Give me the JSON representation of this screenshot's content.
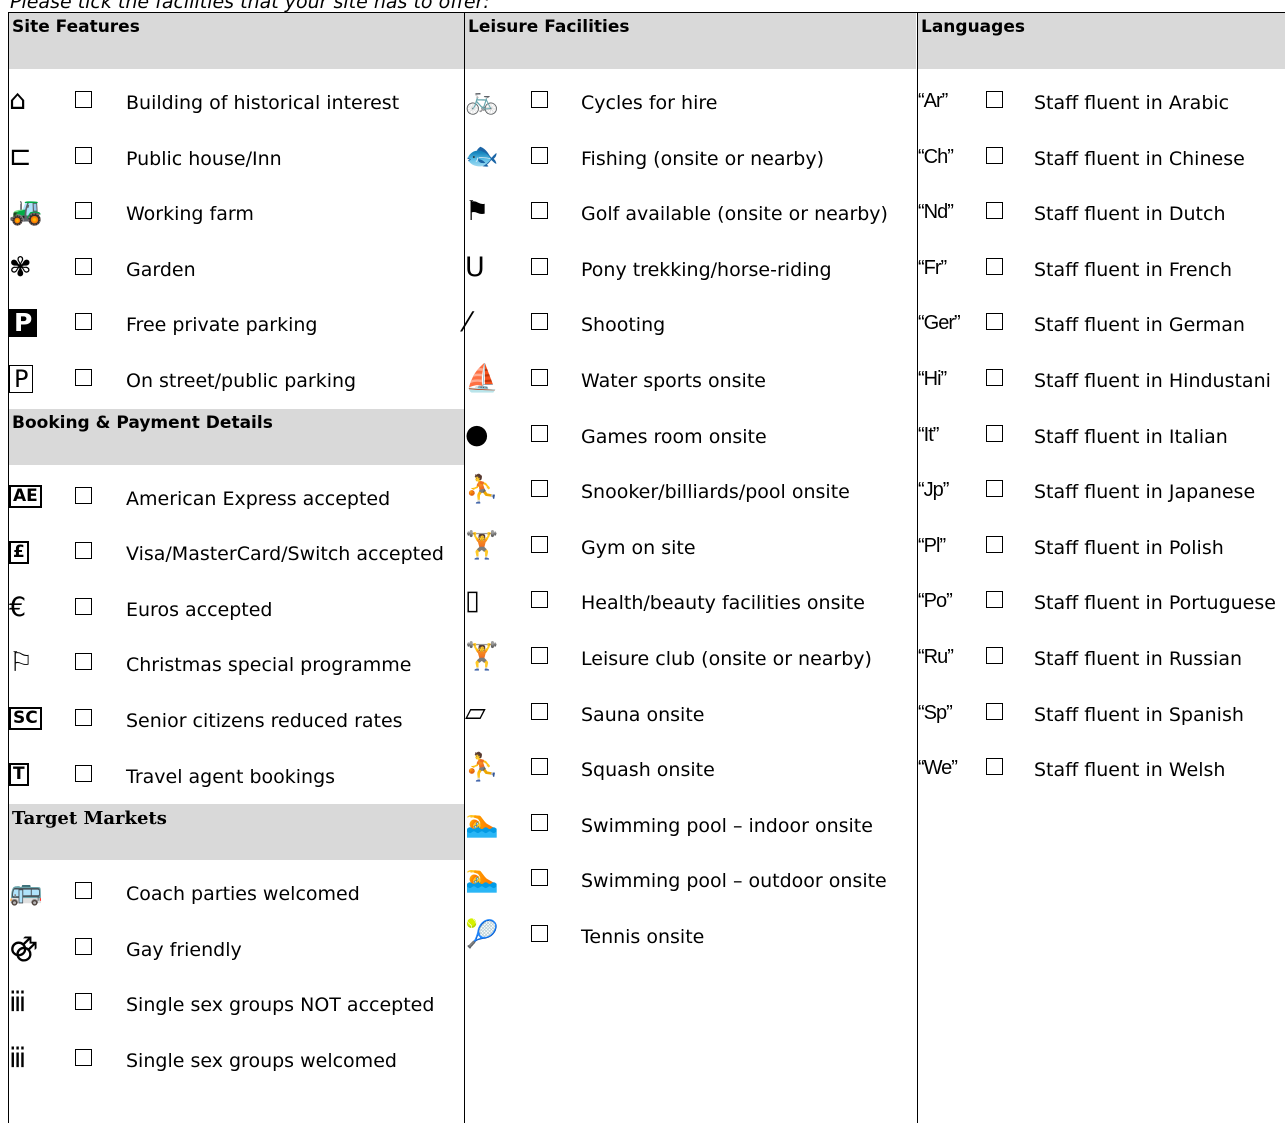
{
  "intro": "Please tick the facilities that your site has to offer:",
  "site_features": {
    "title": "Site Features",
    "items": [
      {
        "icon": "historic-building-icon",
        "glyph": "⌂",
        "label": "Building of historical interest"
      },
      {
        "icon": "pub-icon",
        "glyph": "⊏",
        "label": "Public house/Inn"
      },
      {
        "icon": "tractor-icon",
        "glyph": "🚜",
        "label": "Working farm"
      },
      {
        "icon": "flower-icon",
        "glyph": "✾",
        "label": "Garden"
      },
      {
        "icon": "private-parking-icon",
        "glyph": "P",
        "label": "Free private parking"
      },
      {
        "icon": "public-parking-icon",
        "glyph": "P",
        "label": "On street/public parking"
      }
    ]
  },
  "booking": {
    "title": "Booking & Payment Details",
    "items": [
      {
        "icon": "amex-icon",
        "glyph": "AE",
        "label": "American Express accepted"
      },
      {
        "icon": "card-icon",
        "glyph": "£",
        "label": "Visa/MasterCard/Switch accepted"
      },
      {
        "icon": "euro-icon",
        "glyph": "€",
        "label": "Euros accepted"
      },
      {
        "icon": "christmas-icon",
        "glyph": "⚐",
        "label": "Christmas special programme"
      },
      {
        "icon": "senior-citizens-icon",
        "glyph": "SC",
        "label": "Senior citizens reduced rates"
      },
      {
        "icon": "travel-agent-icon",
        "glyph": "T",
        "label": "Travel agent bookings"
      }
    ]
  },
  "target_markets": {
    "title": "Target Markets",
    "items": [
      {
        "icon": "coach-icon",
        "glyph": "🚌",
        "label": "Coach parties welcomed"
      },
      {
        "icon": "gay-friendly-icon",
        "glyph": "⚣",
        "label": "Gay friendly"
      },
      {
        "icon": "single-sex-not-accepted-icon",
        "glyph": "ⅲ",
        "label": "Single sex groups NOT accepted"
      },
      {
        "icon": "single-sex-welcomed-icon",
        "glyph": "ⅲ",
        "label": "Single sex groups welcomed"
      }
    ]
  },
  "leisure": {
    "title": "Leisure Facilities",
    "items": [
      {
        "icon": "cycle-icon",
        "glyph": "🚲",
        "label": "Cycles for hire"
      },
      {
        "icon": "fishing-icon",
        "glyph": "🐟",
        "label": "Fishing (onsite or nearby)"
      },
      {
        "icon": "golf-flag-icon",
        "glyph": "⚑",
        "label": "Golf available (onsite or nearby)"
      },
      {
        "icon": "horseshoe-icon",
        "glyph": "U",
        "label": "Pony trekking/horse-riding"
      },
      {
        "icon": "shooting-icon",
        "glyph": "⁄",
        "label": "Shooting"
      },
      {
        "icon": "sailboat-icon",
        "glyph": "⛵",
        "label": "Water sports onsite"
      },
      {
        "icon": "table-tennis-icon",
        "glyph": "●",
        "label": "Games room onsite"
      },
      {
        "icon": "snooker-icon",
        "glyph": "⛹",
        "label": "Snooker/billiards/pool onsite"
      },
      {
        "icon": "gym-icon",
        "glyph": "🏋",
        "label": "Gym on site"
      },
      {
        "icon": "beauty-icon",
        "glyph": "▯",
        "label": "Health/beauty facilities onsite"
      },
      {
        "icon": "leisure-club-icon",
        "glyph": "🏋",
        "label": "Leisure club (onsite or nearby)"
      },
      {
        "icon": "sauna-icon",
        "glyph": "▱",
        "label": "Sauna onsite"
      },
      {
        "icon": "squash-icon",
        "glyph": "⛹",
        "label": "Squash onsite"
      },
      {
        "icon": "indoor-pool-icon",
        "glyph": "🏊",
        "label": "Swimming pool – indoor onsite"
      },
      {
        "icon": "outdoor-pool-icon",
        "glyph": "🏊",
        "label": "Swimming pool – outdoor onsite"
      },
      {
        "icon": "tennis-icon",
        "glyph": "🎾",
        "label": "Tennis onsite"
      }
    ]
  },
  "languages": {
    "title": "Languages",
    "items": [
      {
        "icon": "arabic-icon",
        "glyph": "“Ar”",
        "label": "Staff fluent in Arabic"
      },
      {
        "icon": "chinese-icon",
        "glyph": "“Ch”",
        "label": "Staff fluent in Chinese"
      },
      {
        "icon": "dutch-icon",
        "glyph": "“Nd”",
        "label": "Staff fluent in Dutch"
      },
      {
        "icon": "french-icon",
        "glyph": "“Fr”",
        "label": "Staff fluent in French"
      },
      {
        "icon": "german-icon",
        "glyph": "“Ger”",
        "label": "Staff fluent in German"
      },
      {
        "icon": "hindustani-icon",
        "glyph": "“Hi”",
        "label": "Staff fluent in Hindustani"
      },
      {
        "icon": "italian-icon",
        "glyph": "“It”",
        "label": "Staff fluent in Italian"
      },
      {
        "icon": "japanese-icon",
        "glyph": "“Jp”",
        "label": "Staff fluent in Japanese"
      },
      {
        "icon": "polish-icon",
        "glyph": "“Pl”",
        "label": "Staff fluent in Polish"
      },
      {
        "icon": "portuguese-icon",
        "glyph": "“Po”",
        "label": "Staff fluent in Portuguese"
      },
      {
        "icon": "russian-icon",
        "glyph": "“Ru”",
        "label": "Staff fluent in Russian"
      },
      {
        "icon": "spanish-icon",
        "glyph": "“Sp”",
        "label": "Staff fluent in Spanish"
      },
      {
        "icon": "welsh-icon",
        "glyph": "“We”",
        "label": "Staff fluent in Welsh"
      }
    ]
  }
}
